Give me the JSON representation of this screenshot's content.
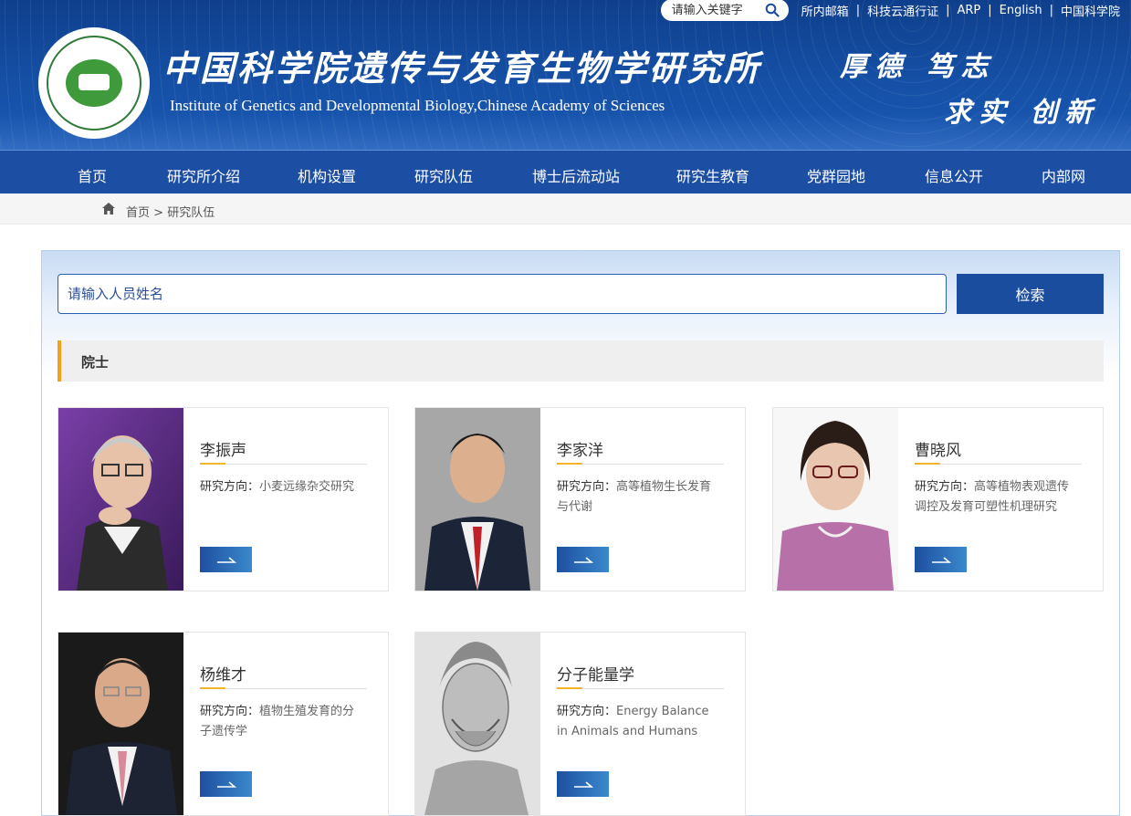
{
  "topbar": {
    "search_placeholder": "请输入关键字",
    "links": [
      "所内邮箱",
      "科技云通行证",
      "ARP",
      "English",
      "中国科学院"
    ],
    "separator": "|"
  },
  "header": {
    "title_cn": "中国科学院遗传与发育生物学研究所",
    "title_en": "Institute of Genetics and Developmental Biology,Chinese Academy of Sciences",
    "motto_line1": "厚德 笃志",
    "motto_line2": "求实 创新"
  },
  "nav": {
    "items": [
      "首页",
      "研究所介绍",
      "机构设置",
      "研究队伍",
      "博士后流动站",
      "研究生教育",
      "党群园地",
      "信息公开",
      "内部网"
    ]
  },
  "breadcrumb": {
    "home": "首页",
    "separator": ">",
    "current": "研究队伍"
  },
  "search": {
    "placeholder": "请输入人员姓名",
    "button": "检索"
  },
  "section": {
    "title": "院士"
  },
  "direction_label": "研究方向：",
  "people": [
    {
      "name": "李振声",
      "direction": "小麦远缘杂交研究",
      "icon": "arrow-right-icon"
    },
    {
      "name": "李家洋",
      "direction": "高等植物生长发育与代谢",
      "icon": "arrow-right-icon"
    },
    {
      "name": "曹晓风",
      "direction": "高等植物表观遗传调控及发育可塑性机理研究",
      "icon": "arrow-right-icon"
    },
    {
      "name": "杨维才",
      "direction": "植物生殖发育的分子遗传学",
      "icon": "arrow-right-icon"
    },
    {
      "name": "分子能量学",
      "direction": "Energy Balance in Animals and Humans",
      "icon": "arrow-right-icon"
    }
  ],
  "colors": {
    "header_blue": "#1550a6",
    "nav_blue": "#1c4ea3",
    "accent_orange": "#f2a11a",
    "button_blue": "#1b4d9e"
  }
}
